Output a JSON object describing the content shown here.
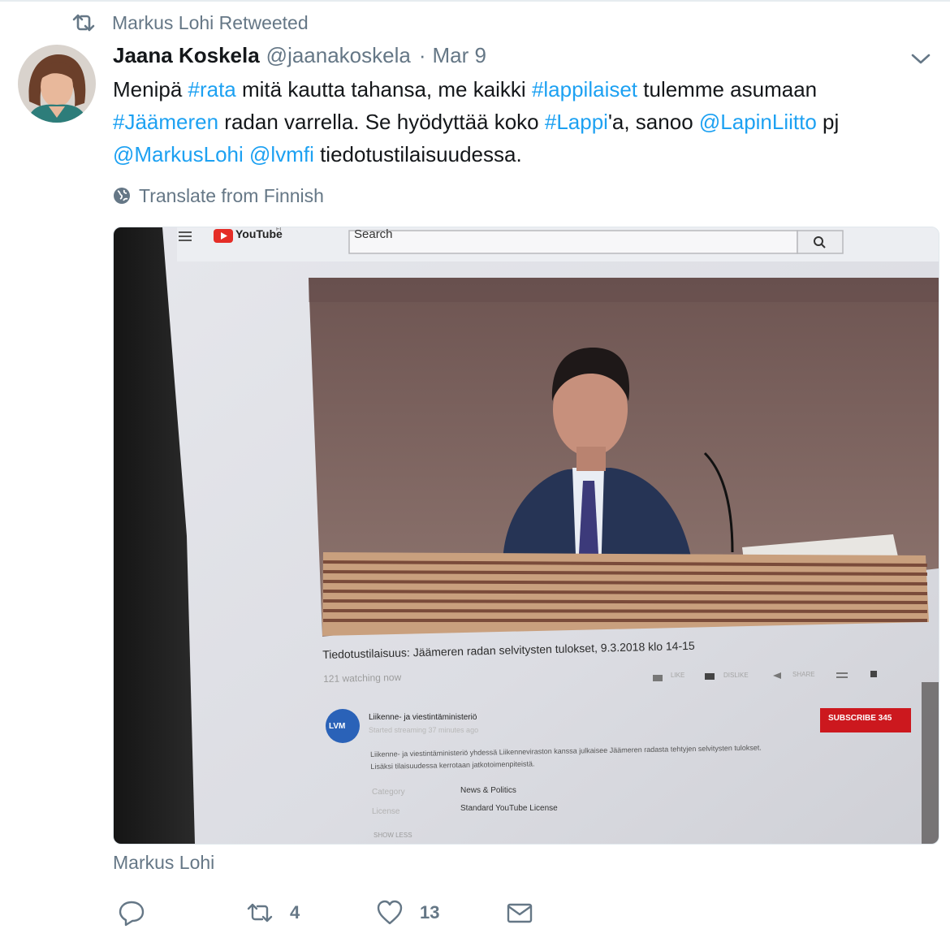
{
  "retweet_label": "Markus Lohi Retweeted",
  "tweet": {
    "author_name": "Jaana Koskela",
    "handle": "@jaanakoskela",
    "separator": "·",
    "date": "Mar 9",
    "text_segments": [
      {
        "t": "Menipä ",
        "link": false
      },
      {
        "t": "#rata",
        "link": true
      },
      {
        "t": " mitä kautta tahansa, me kaikki ",
        "link": false
      },
      {
        "t": "#lappilaiset",
        "link": true
      },
      {
        "t": " tulemme asumaan ",
        "link": false
      },
      {
        "t": "#Jäämeren",
        "link": true
      },
      {
        "t": " radan varrella. Se hyödyttää koko ",
        "link": false
      },
      {
        "t": "#Lappi",
        "link": true
      },
      {
        "t": "'a, sanoo ",
        "link": false
      },
      {
        "t": "@LapinLiitto",
        "link": true
      },
      {
        "t": " pj ",
        "link": false
      },
      {
        "t": "@MarkusLohi",
        "link": true
      },
      {
        "t": " ",
        "link": false
      },
      {
        "t": "@lvmfi",
        "link": true
      },
      {
        "t": " tiedotustilaisuudessa.",
        "link": false
      }
    ],
    "translate_label": "Translate from Finnish",
    "media_caption": "Markus Lohi",
    "actions": {
      "reply_count": "",
      "retweet_count": "4",
      "like_count": "13"
    }
  },
  "media": {
    "youtube_logo": "YouTube",
    "youtube_region": "FI",
    "search_placeholder": "Search",
    "video_title": "Tiedotustilaisuus: Jäämeren radan selvitysten tulokset, 9.3.2018 klo 14-15",
    "watching": "121 watching now",
    "like_label": "LIKE",
    "dislike_label": "DISLIKE",
    "share_label": "SHARE",
    "channel_name": "Liikenne- ja viestintäministeriö",
    "channel_logo": "LVM",
    "started": "Started streaming 37 minutes ago",
    "subscribe": "SUBSCRIBE 345",
    "description": "Liikenne- ja viestintäministeriö yhdessä Liikenneviraston kanssa julkaisee Jäämeren radasta tehtyjen selvitysten tulokset. Lisäksi tilaisuudessa kerrotaan jatkotoimenpiteistä.",
    "category_label": "Category",
    "category_value": "News & Politics",
    "license_label": "License",
    "license_value": "Standard YouTube License",
    "show_less": "SHOW LESS"
  },
  "colors": {
    "link": "#1da1f2",
    "muted": "#657786",
    "text": "#14171a",
    "subscribe": "#cc181e"
  },
  "icons": [
    "retweet-icon",
    "chevron-down-icon",
    "globe-icon",
    "reply-icon",
    "like-icon",
    "direct-message-icon",
    "youtube-logo-icon",
    "search-icon",
    "menu-icon"
  ]
}
